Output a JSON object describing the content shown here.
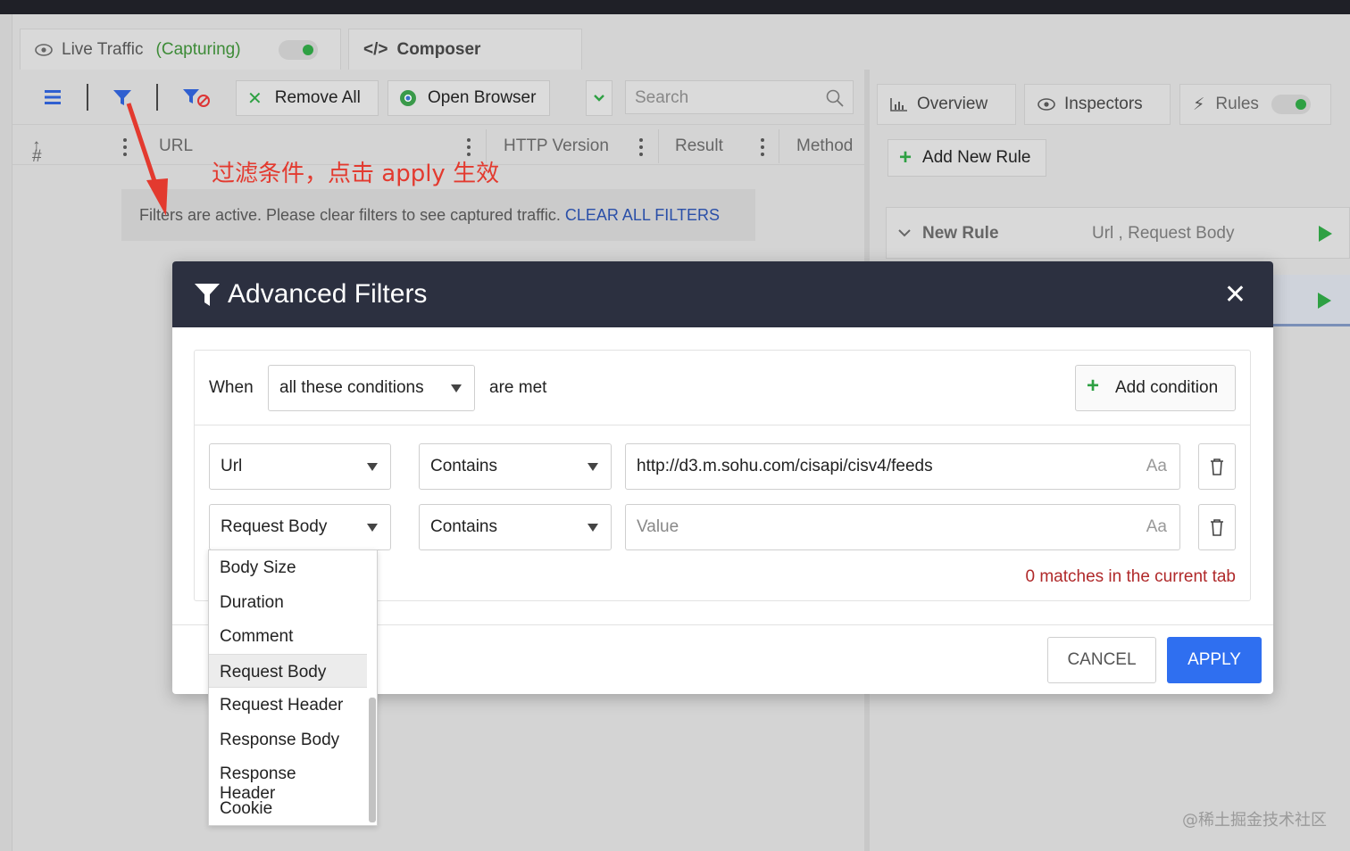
{
  "tabs": {
    "live_traffic": "Live Traffic",
    "capturing": "(Capturing)",
    "composer": "Composer"
  },
  "toolbar": {
    "remove_all": "Remove All",
    "open_browser": "Open Browser",
    "search_placeholder": "Search"
  },
  "columns": {
    "number": "#",
    "url": "URL",
    "http_version": "HTTP Version",
    "result": "Result",
    "method": "Method"
  },
  "annotation": "过滤条件，点击 apply 生效",
  "filter_notice": {
    "text": "Filters are active. Please clear filters to see captured traffic.",
    "link": "CLEAR ALL FILTERS"
  },
  "right_panel": {
    "tabs": [
      "Overview",
      "Inspectors",
      "Rules"
    ],
    "add_new_rule": "Add New Rule",
    "rule": {
      "name": "New Rule",
      "summary": "Url , Request Body"
    }
  },
  "modal": {
    "title": "Advanced Filters",
    "when": "When",
    "match_mode": "all these conditions",
    "are_met": "are met",
    "add_condition": "Add condition",
    "conditions": [
      {
        "field": "Url",
        "operator": "Contains",
        "value": "http://d3.m.sohu.com/cisapi/cisv4/feeds",
        "placeholder": ""
      },
      {
        "field": "Request Body",
        "operator": "Contains",
        "value": "",
        "placeholder": "Value"
      }
    ],
    "case_toggle": "Aa",
    "matches": "0 matches in the current tab",
    "cancel": "CANCEL",
    "apply": "APPLY"
  },
  "dropdown": {
    "items": [
      "Body Size",
      "Duration",
      "Comment",
      "Request Body",
      "Request Header",
      "Response Body",
      "Response Header",
      "Cookie"
    ],
    "selected": "Request Body"
  },
  "watermark": "@稀土掘金技术社区",
  "colors": {
    "accent": "#2f6ff0",
    "header": "#2c3040",
    "green": "#2ea043",
    "error": "#b0292a",
    "annotation": "#e33a2f"
  }
}
